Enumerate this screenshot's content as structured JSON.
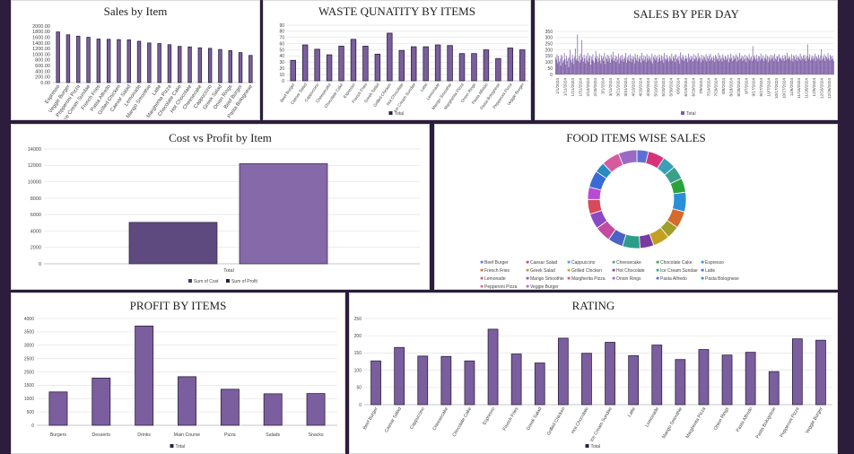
{
  "colors": {
    "bar": "#7b5e9e",
    "bar_stroke": "#2d2240",
    "cost": "#5e4a7e",
    "profit": "#8669a8",
    "grid": "#e4e4e4",
    "axis_text": "#444444"
  },
  "chart_data": [
    {
      "id": "sales_by_item",
      "type": "bar",
      "title": "Sales by Item",
      "categories": [
        "Espresso",
        "Veggie Burger",
        "Pepperoni Pizza",
        "Ice Cream Sundae",
        "French Fries",
        "Pasta Alfredo",
        "Grilled Chicken",
        "Caesar Salad",
        "Lemonade",
        "Mango Smoothie",
        "Latte",
        "Margherita Pizza",
        "Chocolate Cake",
        "Hot Chocolate",
        "Cheesecake",
        "Cappuccino",
        "Greek Salad",
        "Onion Rings",
        "Beef Burger",
        "Pasta Bolognese"
      ],
      "values": [
        1790,
        1690,
        1640,
        1600,
        1540,
        1530,
        1520,
        1510,
        1460,
        1400,
        1380,
        1340,
        1280,
        1260,
        1230,
        1210,
        1170,
        1130,
        1060,
        960
      ],
      "ylim": [
        0,
        2000
      ],
      "yticks": [
        "0.00",
        "200.00",
        "400.00",
        "600.00",
        "800.00",
        "1000.00",
        "1200.00",
        "1400.00",
        "1600.00",
        "1800.00",
        "2000.00"
      ]
    },
    {
      "id": "waste_quantity",
      "type": "bar",
      "title": "WASTE QUNATITY BY ITEMS",
      "categories": [
        "Beef Burger",
        "Caesar Salad",
        "Cappuccino",
        "Cheesecake",
        "Chocolate Cake",
        "Espresso",
        "French Fries",
        "Greek Salad",
        "Grilled Chicken",
        "Hot Chocolate",
        "Ice Cream Sundae",
        "Latte",
        "Lemonade",
        "Mango Smoothie",
        "Margherita Pizza",
        "Onion Rings",
        "Pasta Alfredo",
        "Pasta Bolognese",
        "Pepperoni Pizza",
        "Veggie Burger"
      ],
      "values": [
        33,
        58,
        51,
        42,
        56,
        67,
        56,
        43,
        77,
        49,
        55,
        55,
        58,
        57,
        44,
        44,
        50,
        36,
        53,
        50
      ],
      "ylim": [
        0,
        90
      ],
      "yticks": [
        "0",
        "10",
        "20",
        "30",
        "40",
        "50",
        "60",
        "70",
        "80",
        "90"
      ],
      "legend": [
        "Total"
      ]
    },
    {
      "id": "sales_per_day",
      "type": "bar",
      "title": "SALES BY PER DAY",
      "x_labels": [
        "1/1/2024",
        "1/11/2024",
        "1/21/2024",
        "1/31/2024",
        "2/10/2024",
        "2/20/2024",
        "3/1/2024",
        "3/11/2024",
        "3/21/2024",
        "3/31/2024",
        "4/10/2024",
        "4/20/2024",
        "4/30/2024",
        "5/10/2024",
        "5/20/2024",
        "5/30/2024",
        "6/9/2024",
        "6/19/2024",
        "6/29/2024",
        "7/9/2024",
        "7/19/2024",
        "7/29/2024",
        "8/8/2024",
        "8/18/2024",
        "8/28/2024",
        "9/7/2024",
        "9/17/2024",
        "9/27/2024",
        "10/7/2024",
        "10/17/2024",
        "10/27/2024",
        "11/6/2024",
        "11/16/2024",
        "11/26/2024",
        "12/6/2024",
        "12/16/2024",
        "12/26/2024"
      ],
      "values": [
        140,
        120,
        165,
        90,
        150,
        105,
        130,
        70,
        160,
        145,
        95,
        115,
        175,
        125,
        80,
        150,
        110,
        135,
        60,
        140,
        200,
        120,
        95,
        160,
        130,
        85,
        145,
        210,
        115,
        130,
        325,
        110,
        150,
        95,
        170,
        120,
        280,
        140,
        105,
        160,
        130,
        90,
        150,
        115,
        175,
        100,
        135,
        155,
        80,
        145,
        120,
        165,
        110,
        95,
        140,
        190,
        125,
        150,
        100,
        135,
        170,
        115,
        90,
        155,
        130,
        145,
        110,
        175,
        85,
        140,
        125,
        160,
        105,
        150,
        130,
        95,
        165,
        120,
        140,
        185,
        110,
        130,
        155,
        100,
        145,
        120,
        170,
        90,
        135,
        150,
        115,
        160,
        125,
        105,
        145,
        130,
        175,
        95,
        140,
        120,
        155,
        110,
        165,
        130,
        100,
        150,
        125,
        145,
        90,
        170,
        135,
        115,
        160,
        105,
        140,
        125,
        150,
        95,
        175,
        130,
        110,
        155,
        120,
        145,
        100,
        165,
        135,
        115,
        150,
        125,
        140,
        105,
        170,
        90,
        145,
        130,
        160,
        115,
        135,
        150,
        100,
        125,
        165,
        140,
        110,
        155,
        120,
        145,
        95,
        175,
        130,
        115,
        160,
        125,
        140,
        105,
        150,
        135,
        120,
        170,
        110,
        145,
        130,
        155,
        100,
        165,
        125,
        140,
        115,
        150,
        90,
        180,
        135,
        120,
        160,
        145,
        110,
        130,
        155,
        125,
        140,
        100,
        170,
        135,
        115,
        150,
        125,
        145,
        105,
        165,
        130,
        120,
        155,
        140,
        110,
        175,
        125,
        145,
        135,
        100,
        160,
        130,
        115,
        150,
        140,
        120,
        165,
        105,
        145,
        130,
        155,
        110,
        170,
        125,
        140,
        115,
        150,
        135,
        100,
        160,
        145,
        120,
        130,
        175,
        110,
        155,
        125,
        140,
        105,
        165,
        135,
        120,
        150,
        145,
        115,
        130,
        160,
        100,
        140,
        125,
        170,
        135,
        110,
        155,
        120,
        145,
        130,
        165,
        105,
        150,
        140,
        115,
        175,
        125,
        135,
        155,
        110,
        145,
        120,
        160,
        130,
        100,
        150,
        140,
        125,
        165,
        115,
        135,
        145,
        110,
        230,
        125,
        155,
        140,
        120,
        160,
        130,
        105,
        150,
        145,
        115,
        170,
        135,
        125,
        155,
        110,
        140,
        130,
        165,
        120,
        150,
        100,
        145,
        135,
        115,
        160,
        125,
        140,
        155,
        110,
        170,
        130,
        120,
        145,
        150,
        105,
        165,
        135,
        125,
        140,
        115,
        155,
        130,
        110,
        160,
        145,
        120,
        175,
        135,
        125,
        150,
        140,
        115,
        165,
        130,
        105,
        155,
        145,
        120,
        160,
        135,
        110,
        150,
        140,
        125,
        170,
        115,
        145,
        130,
        155,
        120,
        160,
        135,
        110,
        150,
        245,
        125,
        140,
        165,
        115,
        135,
        155,
        120,
        145,
        130,
        170,
        110,
        150,
        140,
        125,
        160,
        135,
        115,
        155,
        205,
        120,
        145,
        130,
        165,
        110,
        150,
        140,
        125,
        175,
        135,
        115,
        160,
        145,
        120,
        150,
        130,
        110
      ],
      "ylim": [
        0,
        350
      ],
      "yticks": [
        "0",
        "50",
        "100",
        "150",
        "200",
        "250",
        "300",
        "350"
      ],
      "legend": [
        "Total"
      ]
    },
    {
      "id": "cost_vs_profit",
      "type": "bar",
      "title": "Cost vs Profit by Item",
      "categories": [
        "Total"
      ],
      "series": [
        {
          "name": "Sum of Cost",
          "values": [
            5050
          ]
        },
        {
          "name": "Sum of Profit",
          "values": [
            12200
          ]
        }
      ],
      "ylim": [
        0,
        14000
      ],
      "yticks": [
        "0",
        "2000",
        "4000",
        "6000",
        "8000",
        "10000",
        "12000",
        "14000"
      ]
    },
    {
      "id": "food_items_wise_sales",
      "type": "pie",
      "title": "FOOD ITEMS  WISE SALES",
      "categories": [
        "Beef Burger",
        "Caesar Salad",
        "Cappuccino",
        "Cheesecake",
        "Chocolate Cake",
        "Espresso",
        "French Fries",
        "Greek Salad",
        "Grilled Chicken",
        "Hot Chocolate",
        "Ice Cream Sundae",
        "Latte",
        "Lemonade",
        "Mango Smoothie",
        "Margherita Pizza",
        "Onion Rings",
        "Pasta Alfredo",
        "Pasta Bolognese",
        "Pepperoni Pizza",
        "Veggie Burger"
      ],
      "values": [
        1060,
        1510,
        1210,
        1230,
        1280,
        1790,
        1540,
        1170,
        1520,
        1260,
        1600,
        1380,
        1460,
        1400,
        1340,
        1130,
        1530,
        960,
        1640,
        1690
      ],
      "colors": [
        "#5b6fd6",
        "#d6337a",
        "#3aa0b8",
        "#3aa08a",
        "#27a33a",
        "#2a8fd6",
        "#d66a2a",
        "#9e9e2a",
        "#c4a020",
        "#7a3aa0",
        "#2a9e8a",
        "#4a63c4",
        "#c44aa0",
        "#8a4ac4",
        "#d64a5a",
        "#b84ad6",
        "#3a6ad6",
        "#2a8ac4",
        "#d65aa0",
        "#9a6ac4"
      ]
    },
    {
      "id": "profit_by_items",
      "type": "bar",
      "title": "PROFIT BY ITEMS",
      "categories": [
        "Burgers",
        "Desserts",
        "Drinks",
        "Main Course",
        "Pizza",
        "Salads",
        "Snacks"
      ],
      "values": [
        1250,
        1770,
        3720,
        1820,
        1350,
        1180,
        1190
      ],
      "ylim": [
        0,
        4000
      ],
      "yticks": [
        "0",
        "500",
        "1000",
        "1500",
        "2000",
        "2500",
        "3000",
        "3500",
        "4000"
      ],
      "legend": [
        "Total"
      ]
    },
    {
      "id": "rating",
      "type": "bar",
      "title": "RATING",
      "categories": [
        "Beef Burger",
        "Caesar Salad",
        "Cappuccino",
        "Cheesecake",
        "Chocolate Cake",
        "Espresso",
        "French Fries",
        "Greek Salad",
        "Grilled Chicken",
        "Hot Chocolate",
        "Ice Cream Sundae",
        "Latte",
        "Lemonade",
        "Mango Smoothie",
        "Margherita Pizza",
        "Onion Rings",
        "Pasta Alfredo",
        "Pasta Bolognese",
        "Pepperoni Pizza",
        "Veggie Burger"
      ],
      "values": [
        127,
        166,
        141,
        140,
        127,
        219,
        147,
        121,
        193,
        149,
        181,
        142,
        173,
        131,
        160,
        144,
        152,
        96,
        191,
        187
      ],
      "ylim": [
        0,
        250
      ],
      "yticks": [
        "0",
        "50",
        "100",
        "150",
        "200",
        "250"
      ],
      "legend": [
        "Total"
      ]
    }
  ]
}
